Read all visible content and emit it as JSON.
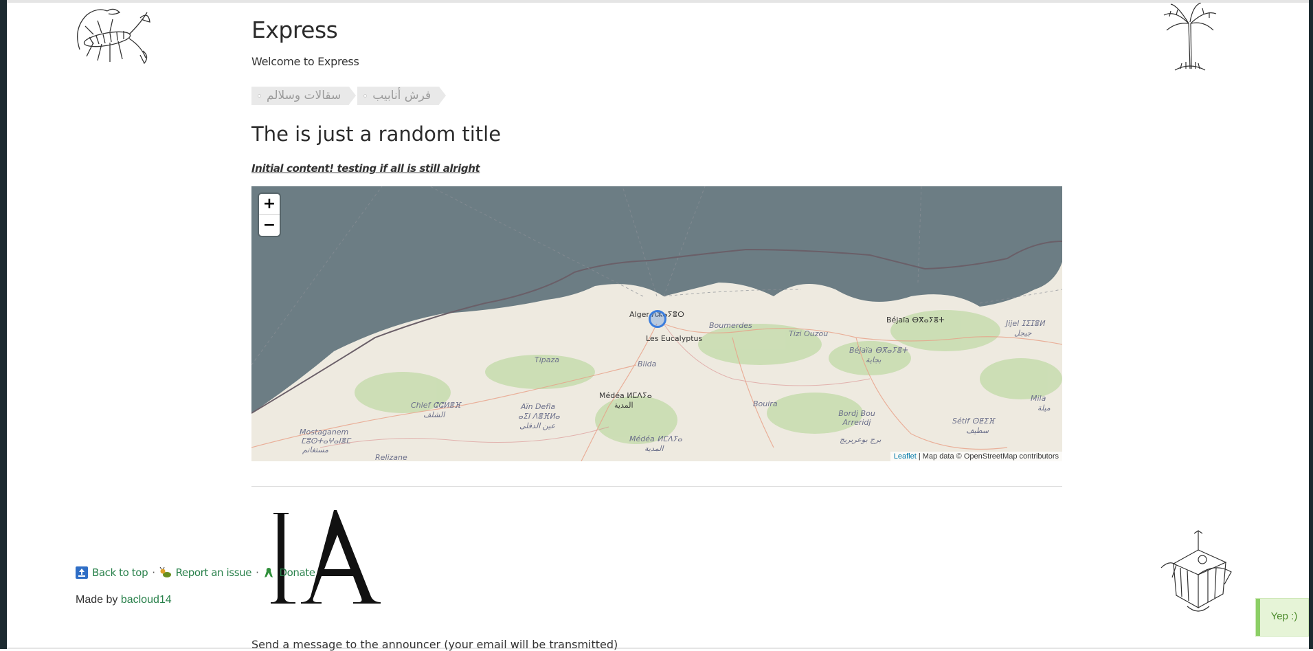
{
  "header": {
    "title": "Express",
    "subtitle": "Welcome to Express"
  },
  "tags": [
    {
      "label": "سقالات وسلالم"
    },
    {
      "label": "فرش أنابيب"
    }
  ],
  "post": {
    "title": "The is just a random title",
    "intro": "Initial content! testing if all is still alright"
  },
  "map": {
    "zoom_in": "+",
    "zoom_out": "−",
    "attribution_link": "Leaflet",
    "attribution_text": " | Map data © OpenStreetMap contributors",
    "sea_color": "#6c7d84",
    "land_color": "#eeeae0",
    "labels": [
      "Alger ⴷⵣⴰⵢⴻⵔ",
      "Les Eucalyptus",
      "Boumerdes",
      "Tizi Ouzou",
      "Béjaïa ⴱⴳⴰⵢⴻⵜ",
      "Béjaïa ⴱⴳⴰⵢⴻⵜ",
      "بجاية",
      "Jijel ⵊⵉⵊⴻⵍ",
      "جيجل",
      "Tipaza",
      "Blida",
      "Médéa ⵍⵎⴷⵢⴰ",
      "المدية",
      "Chlef ⵛⵛⵍⴻⴼ",
      "الشلف",
      "Aïn Defla",
      "ⴰⵉⵏ ⴷⴻⴼⵍⴰ",
      "عين الدفلى",
      "Bouira",
      "Bordj Bou Arreridj",
      "برج بوعريريج",
      "Sétif ⵙⵟⵉⴼ",
      "سطيف",
      "Mila",
      "ميلة",
      "Mostaganem",
      "ⵎⵓⵙⵜⴰⵖⴰⵏⴻⵎ",
      "مستغانم",
      "Relizane",
      "Médéa ⵍⵎⴷⵢⴰ",
      "المدية"
    ]
  },
  "logo": {
    "text": "lA"
  },
  "contact": {
    "text": "Send a message to the announcer (your email will be transmitted)"
  },
  "footer": {
    "back_to_top": "Back to top",
    "report_issue": "Report an issue",
    "donate": "Donate",
    "separator": "·",
    "made_by_prefix": "Made by ",
    "made_by_author": "bacloud14"
  },
  "toast": {
    "label": "Yep :)"
  },
  "colors": {
    "link": "#28804a",
    "tag_bg": "#e9e9e9",
    "toast_accent": "#8ccf66"
  }
}
